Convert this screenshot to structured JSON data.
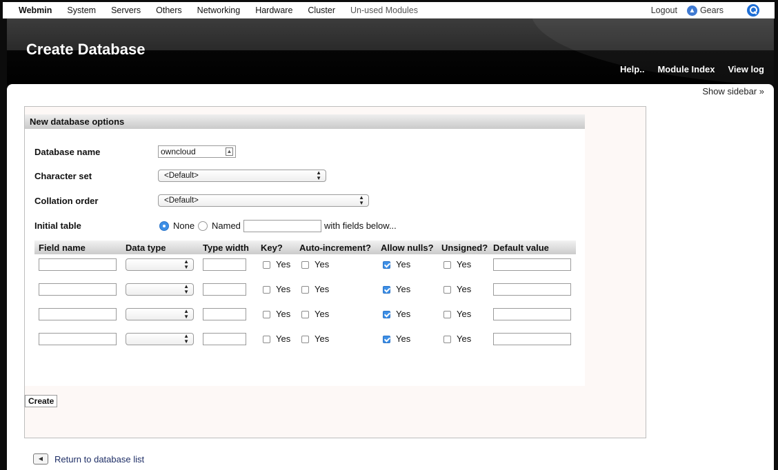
{
  "topbar": {
    "brand": "Webmin",
    "menu": [
      "System",
      "Servers",
      "Others",
      "Networking",
      "Hardware",
      "Cluster",
      "Un-used Modules"
    ],
    "logout": "Logout",
    "gears": "Gears"
  },
  "header": {
    "title": "Create Database",
    "links": [
      "Help..",
      "Module Index",
      "View log"
    ]
  },
  "show_sidebar": "Show sidebar »",
  "form": {
    "section_title": "New database options",
    "db_name_label": "Database name",
    "db_name_value": "owncloud",
    "charset_label": "Character set",
    "charset_value": "<Default>",
    "collation_label": "Collation order",
    "collation_value": "<Default>",
    "initial_table_label": "Initial table",
    "none_label": "None",
    "named_label": "Named",
    "named_value": "",
    "fields_suffix": "with fields below...",
    "initial_table_selected": "None"
  },
  "fields_table": {
    "columns": [
      "Field name",
      "Data type",
      "Type width",
      "Key?",
      "Auto-increment?",
      "Allow nulls?",
      "Unsigned?",
      "Default value"
    ],
    "yes_label": "Yes",
    "rows": [
      {
        "field_name": "",
        "data_type": "",
        "type_width": "",
        "key": false,
        "auto_increment": false,
        "allow_nulls": true,
        "unsigned": false,
        "default_value": ""
      },
      {
        "field_name": "",
        "data_type": "",
        "type_width": "",
        "key": false,
        "auto_increment": false,
        "allow_nulls": true,
        "unsigned": false,
        "default_value": ""
      },
      {
        "field_name": "",
        "data_type": "",
        "type_width": "",
        "key": false,
        "auto_increment": false,
        "allow_nulls": true,
        "unsigned": false,
        "default_value": ""
      },
      {
        "field_name": "",
        "data_type": "",
        "type_width": "",
        "key": false,
        "auto_increment": false,
        "allow_nulls": true,
        "unsigned": false,
        "default_value": ""
      }
    ]
  },
  "create_button": "Create",
  "return_link": "Return to database list",
  "colors": {
    "accent": "#3d8fe6",
    "link": "#1e2e66",
    "header_bg": "#000000"
  }
}
